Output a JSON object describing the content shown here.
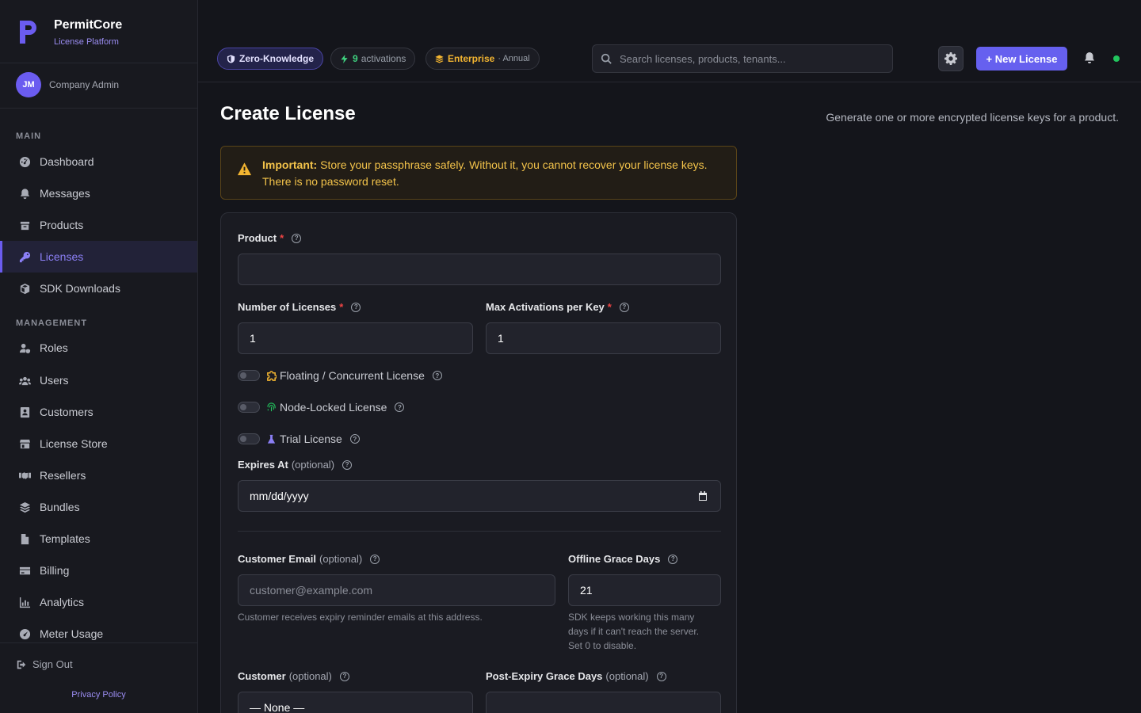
{
  "brand": {
    "title": "PermitCore",
    "subtitle": "License Platform"
  },
  "user": {
    "initials": "JM",
    "role": "Company Admin"
  },
  "nav": {
    "section_main": "MAIN",
    "section_management": "MANAGEMENT",
    "main_items": [
      {
        "label": "Dashboard",
        "icon": "dashboard-icon"
      },
      {
        "label": "Messages",
        "icon": "bell-icon"
      },
      {
        "label": "Products",
        "icon": "box-icon"
      },
      {
        "label": "Licenses",
        "icon": "key-icon",
        "active": true
      },
      {
        "label": "SDK Downloads",
        "icon": "package-icon"
      }
    ],
    "management_items": [
      {
        "label": "Roles",
        "icon": "user-shield-icon"
      },
      {
        "label": "Users",
        "icon": "users-icon"
      },
      {
        "label": "Customers",
        "icon": "contact-card-icon"
      },
      {
        "label": "License Store",
        "icon": "store-icon"
      },
      {
        "label": "Resellers",
        "icon": "handshake-icon"
      },
      {
        "label": "Bundles",
        "icon": "layers-icon"
      },
      {
        "label": "Templates",
        "icon": "file-icon"
      },
      {
        "label": "Billing",
        "icon": "credit-card-icon"
      },
      {
        "label": "Analytics",
        "icon": "chart-icon"
      },
      {
        "label": "Meter Usage",
        "icon": "gauge-icon"
      }
    ],
    "sign_out": "Sign Out",
    "privacy": "Privacy Policy"
  },
  "topbar": {
    "zk_badge": "Zero-Knowledge",
    "activations_count": "9",
    "activations_label": "activations",
    "plan_name": "Enterprise",
    "plan_cycle": "· Annual",
    "search_placeholder": "Search licenses, products, tenants...",
    "new_license_label": "+ New License"
  },
  "page": {
    "title": "Create License",
    "description": "Generate one or more encrypted license keys for a product."
  },
  "alert": {
    "strong": "Important:",
    "text": " Store your passphrase safely. Without it, you cannot recover your license keys. There is no password reset."
  },
  "form": {
    "product_label": "Product",
    "product_value": "",
    "num_licenses_label": "Number of Licenses",
    "num_licenses_value": "1",
    "max_activations_label": "Max Activations per Key",
    "max_activations_value": "1",
    "required_marker": "*",
    "help_glyph": "?",
    "floating_label": "Floating / Concurrent License",
    "node_locked_label": "Node-Locked License",
    "trial_label": "Trial License",
    "expires_label": "Expires At",
    "optional_text": "(optional)",
    "expires_value": "mm/dd/yyyy",
    "customer_email_label": "Customer Email",
    "customer_email_placeholder": "customer@example.com",
    "customer_email_hint": "Customer receives expiry reminder emails at this address.",
    "offline_grace_label": "Offline Grace Days",
    "offline_grace_value": "21",
    "offline_grace_hint": "SDK keeps working this many days if it can't reach the server. Set 0 to disable.",
    "customer_label": "Customer",
    "customer_value": "— None —",
    "post_expiry_label": "Post-Expiry Grace Days",
    "post_expiry_value": ""
  },
  "colors": {
    "accent": "#6660ef",
    "warning": "#f3c34a",
    "success": "#22c55e",
    "required": "#ef4444"
  }
}
